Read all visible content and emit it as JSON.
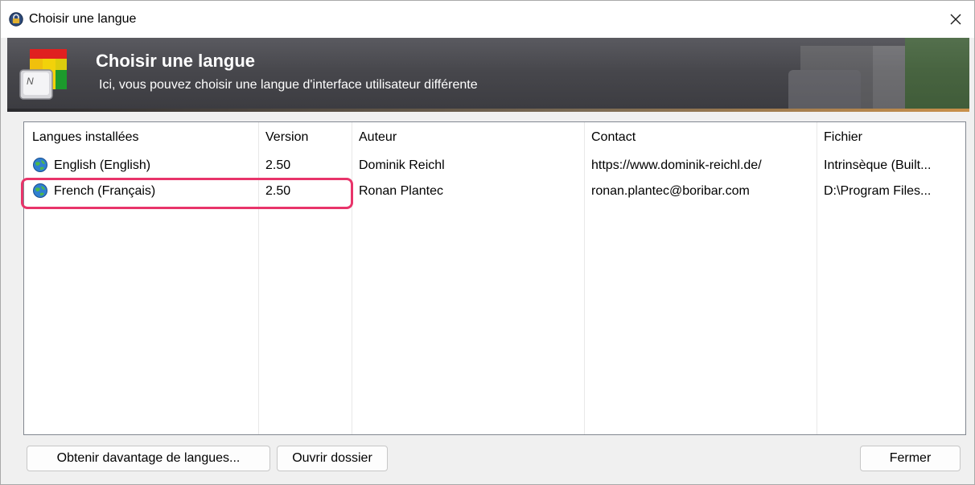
{
  "window": {
    "title": "Choisir une langue",
    "close_icon": "close-icon"
  },
  "banner": {
    "title": "Choisir une langue",
    "subtitle": "Ici, vous pouvez choisir une langue d'interface utilisateur différente"
  },
  "table": {
    "columns": [
      "Langues installées",
      "Version",
      "Auteur",
      "Contact",
      "Fichier"
    ],
    "rows": [
      {
        "language": "English (English)",
        "version": "2.50",
        "author": "Dominik Reichl",
        "contact": "https://www.dominik-reichl.de/",
        "file": "Intrinsèque (Built..."
      },
      {
        "language": "French (Français)",
        "version": "2.50",
        "author": "Ronan Plantec",
        "contact": "ronan.plantec@boribar.com",
        "file": "D:\\Program Files..."
      }
    ]
  },
  "buttons": {
    "get_more": "Obtenir davantage de langues...",
    "open_folder": "Ouvrir dossier",
    "close": "Fermer"
  },
  "colors": {
    "highlight": "#e8346a",
    "banner": "#47474c"
  }
}
